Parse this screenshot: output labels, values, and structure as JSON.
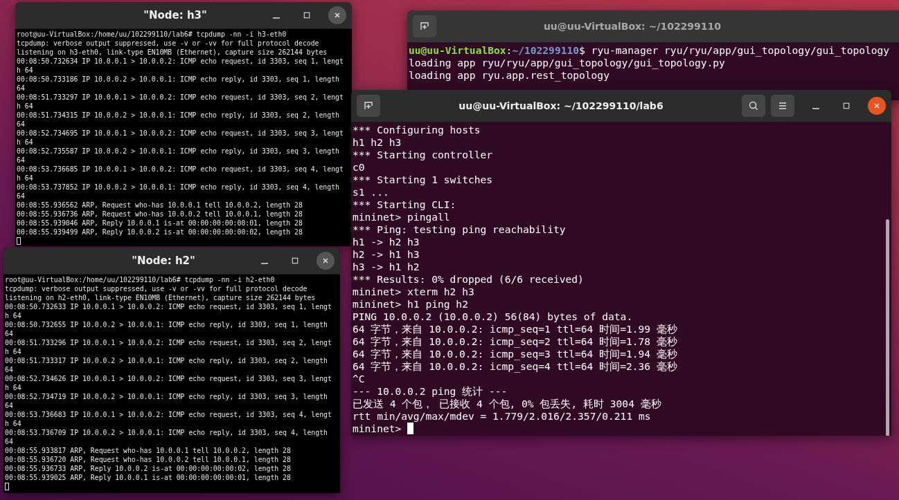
{
  "windows": [
    {
      "kind": "gnome",
      "title": "uu@uu-VirtualBox: ~/102299110",
      "focused": false,
      "cursor": false,
      "prompt": {
        "user": "uu@uu-VirtualBox",
        "separator": ":",
        "path": "~/102299110",
        "command": "$ ryu-manager ryu/ryu/app/gui_topology/gui_topology"
      },
      "lines": [
        "loading app ryu/ryu/app/gui_topology/gui_topology.py",
        "loading app ryu.app.rest_topology"
      ]
    },
    {
      "kind": "xterm",
      "title": "\"Node: h3\"",
      "cursor": true,
      "lines": [
        "root@uu-VirtualBox:/home/uu/102299110/lab6# tcpdump -nn -i h3-eth0",
        "tcpdump: verbose output suppressed, use -v or -vv for full protocol decode",
        "listening on h3-eth0, link-type EN10MB (Ethernet), capture size 262144 bytes",
        "00:08:50.732634 IP 10.0.0.1 > 10.0.0.2: ICMP echo request, id 3303, seq 1, lengt",
        "h 64",
        "00:08:50.733186 IP 10.0.0.2 > 10.0.0.1: ICMP echo reply, id 3303, seq 1, length",
        "64",
        "00:08:51.733297 IP 10.0.0.1 > 10.0.0.2: ICMP echo request, id 3303, seq 2, lengt",
        "h 64",
        "00:08:51.734315 IP 10.0.0.2 > 10.0.0.1: ICMP echo reply, id 3303, seq 2, length",
        "64",
        "00:08:52.734695 IP 10.0.0.1 > 10.0.0.2: ICMP echo request, id 3303, seq 3, lengt",
        "h 64",
        "00:08:52.735587 IP 10.0.0.2 > 10.0.0.1: ICMP echo reply, id 3303, seq 3, length",
        "64",
        "00:08:53.736685 IP 10.0.0.1 > 10.0.0.2: ICMP echo request, id 3303, seq 4, lengt",
        "h 64",
        "00:08:53.737852 IP 10.0.0.2 > 10.0.0.1: ICMP echo reply, id 3303, seq 4, length",
        "64",
        "00:08:55.936562 ARP, Request who-has 10.0.0.1 tell 10.0.0.2, length 28",
        "00:08:55.936736 ARP, Request who-has 10.0.0.2 tell 10.0.0.1, length 28",
        "00:08:55.939046 ARP, Reply 10.0.0.1 is-at 00:00:00:00:00:01, length 28",
        "00:08:55.939499 ARP, Reply 10.0.0.2 is-at 00:00:00:00:00:02, length 28"
      ]
    },
    {
      "kind": "xterm",
      "title": "\"Node: h2\"",
      "cursor": true,
      "lines": [
        "root@uu-VirtualBox:/home/uu/102299110/lab6# tcpdump -nn -i h2-eth0",
        "tcpdump: verbose output suppressed, use -v or -vv for full protocol decode",
        "listening on h2-eth0, link-type EN10MB (Ethernet), capture size 262144 bytes",
        "00:08:50.732633 IP 10.0.0.1 > 10.0.0.2: ICMP echo request, id 3303, seq 1, lengt",
        "h 64",
        "00:08:50.732655 IP 10.0.0.2 > 10.0.0.1: ICMP echo reply, id 3303, seq 1, length",
        "64",
        "00:08:51.733296 IP 10.0.0.1 > 10.0.0.2: ICMP echo request, id 3303, seq 2, lengt",
        "h 64",
        "00:08:51.733317 IP 10.0.0.2 > 10.0.0.1: ICMP echo reply, id 3303, seq 2, length",
        "64",
        "00:08:52.734626 IP 10.0.0.1 > 10.0.0.2: ICMP echo request, id 3303, seq 3, lengt",
        "h 64",
        "00:08:52.734719 IP 10.0.0.2 > 10.0.0.1: ICMP echo reply, id 3303, seq 3, length",
        "64",
        "00:08:53.736683 IP 10.0.0.1 > 10.0.0.2: ICMP echo request, id 3303, seq 4, lengt",
        "h 64",
        "00:08:53.736709 IP 10.0.0.2 > 10.0.0.1: ICMP echo reply, id 3303, seq 4, length",
        "64",
        "00:08:55.933817 ARP, Request who-has 10.0.0.1 tell 10.0.0.2, length 28",
        "00:08:55.936720 ARP, Request who-has 10.0.0.2 tell 10.0.0.1, length 28",
        "00:08:55.936733 ARP, Reply 10.0.0.2 is-at 00:00:00:00:00:02, length 28",
        "00:08:55.939025 ARP, Reply 10.0.0.1 is-at 00:00:00:00:00:01, length 28"
      ]
    },
    {
      "kind": "gnome",
      "title": "uu@uu-VirtualBox: ~/102299110/lab6",
      "focused": true,
      "cursor": true,
      "lines": [
        "*** Configuring hosts",
        "h1 h2 h3",
        "*** Starting controller",
        "c0",
        "*** Starting 1 switches",
        "s1 ...",
        "*** Starting CLI:",
        "mininet> pingall",
        "*** Ping: testing ping reachability",
        "h1 -> h2 h3",
        "h2 -> h1 h3",
        "h3 -> h1 h2",
        "*** Results: 0% dropped (6/6 received)",
        "mininet> xterm h2 h3",
        "mininet> h1 ping h2",
        "PING 10.0.0.2 (10.0.0.2) 56(84) bytes of data.",
        "64 字节，来自 10.0.0.2: icmp_seq=1 ttl=64 时间=1.99 毫秒",
        "64 字节，来自 10.0.0.2: icmp_seq=2 ttl=64 时间=1.78 毫秒",
        "64 字节，来自 10.0.0.2: icmp_seq=3 ttl=64 时间=1.94 毫秒",
        "64 字节，来自 10.0.0.2: icmp_seq=4 ttl=64 时间=2.36 毫秒",
        "^C",
        "--- 10.0.0.2 ping 统计 ---",
        "已发送 4 个包， 已接收 4 个包, 0% 包丢失, 耗时 3004 毫秒",
        "rtt min/avg/max/mdev = 1.779/2.016/2.357/0.211 ms",
        "mininet> "
      ]
    }
  ]
}
